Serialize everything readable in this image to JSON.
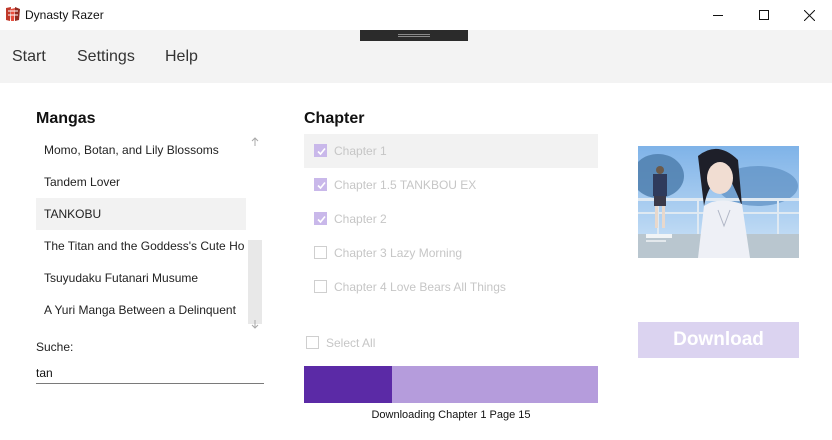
{
  "window": {
    "title": "Dynasty Razer"
  },
  "menu": {
    "items": [
      "Start",
      "Settings",
      "Help"
    ]
  },
  "mangas": {
    "heading": "Mangas",
    "items": [
      "Momo, Botan, and Lily Blossoms",
      "Tandem Lover",
      "TANKOBU",
      "The Titan and the Goddess's Cute Ho",
      "Tsuyudaku Futanari Musume",
      "A Yuri Manga Between a Delinquent"
    ],
    "selected_index": 2
  },
  "search": {
    "label": "Suche:",
    "value": "tan"
  },
  "chapters": {
    "heading": "Chapter",
    "items": [
      {
        "label": "Chapter 1",
        "checked": true
      },
      {
        "label": "Chapter 1.5 TANKBOU EX",
        "checked": true
      },
      {
        "label": "Chapter 2",
        "checked": true
      },
      {
        "label": "Chapter 3 Lazy Morning",
        "checked": false
      },
      {
        "label": "Chapter 4 Love Bears All Things",
        "checked": false
      }
    ],
    "select_all_label": "Select All",
    "select_all_checked": false
  },
  "progress": {
    "fraction": 0.3,
    "text": "Downloading Chapter 1 Page 15"
  },
  "download_label": "Download",
  "colors": {
    "accent": "#5b2aa6",
    "accent_light": "#b59cdc",
    "checkbox_checked": "#c9b8ea",
    "download_disabled": "#dbd3f0",
    "menubar_bg": "#f3f3f3"
  },
  "icons": {
    "app": "app-icon",
    "minimize": "minimize-icon",
    "maximize": "maximize-icon",
    "close": "close-icon",
    "scroll_up": "arrow-up-icon",
    "scroll_down": "arrow-down-icon",
    "check": "checkmark-icon"
  }
}
